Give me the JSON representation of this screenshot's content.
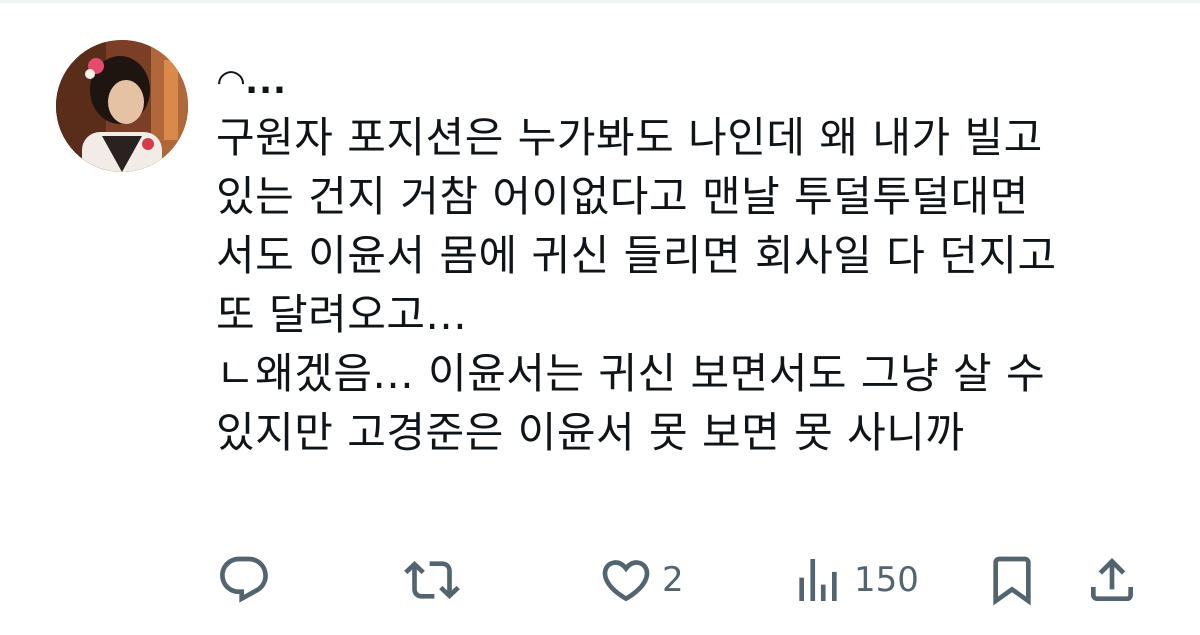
{
  "tweet": {
    "username": "◠...",
    "body": "구원자 포지션은 누가봐도 나인데 왜 내가 빌고\n있는 건지 거참 어이없다고 맨날 투덜투덜대면\n서도 이윤서 몸에 귀신 들리면 회사일 다 던지고\n또 달려오고...\nㄴ왜겠음... 이윤서는 귀신 보면서도 그냥 살 수\n있지만 고경준은 이윤서 못 보면 못 사니까"
  },
  "actions": {
    "reply_icon": "reply-icon",
    "retweet_icon": "retweet-icon",
    "like_icon": "heart-icon",
    "like_count": "2",
    "views_icon": "views-icon",
    "views_count": "150",
    "bookmark_icon": "bookmark-icon",
    "share_icon": "share-icon"
  },
  "colors": {
    "text": "#0f1419",
    "muted": "#536471"
  }
}
